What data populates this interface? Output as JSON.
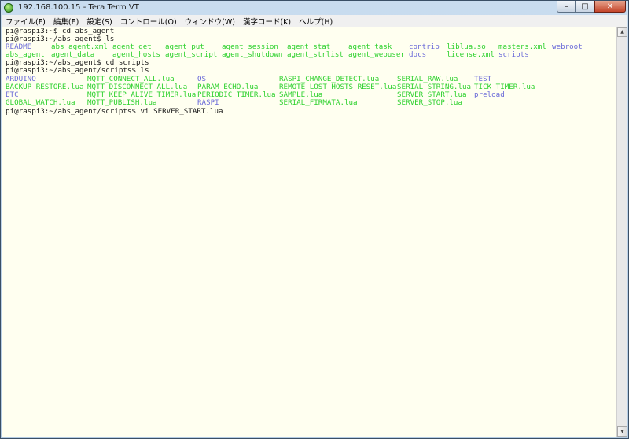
{
  "window": {
    "title": "192.168.100.15 - Tera Term VT",
    "minimize": "–",
    "maximize": "□",
    "close": "✕"
  },
  "menu": [
    "ファイル(F)",
    "編集(E)",
    "設定(S)",
    "コントロール(O)",
    "ウィンドウ(W)",
    "漢字コード(K)",
    "ヘルプ(H)"
  ],
  "colors": {
    "directory": "#6a6ad8",
    "file": "#2ed12e",
    "text": "#1a1a1a",
    "background": "#fffff0"
  },
  "terminal": {
    "prompt1": "pi@raspi3:~$ cd abs_agent",
    "prompt2": "pi@raspi3:~/abs_agent$ ls",
    "ls1_row1": [
      {
        "text": "README",
        "color": "blue"
      },
      {
        "text": "abs_agent.xml",
        "color": "green"
      },
      {
        "text": "agent_get",
        "color": "green"
      },
      {
        "text": "agent_put",
        "color": "green"
      },
      {
        "text": "agent_session",
        "color": "green"
      },
      {
        "text": "agent_stat",
        "color": "green"
      },
      {
        "text": "agent_task",
        "color": "green"
      },
      {
        "text": "contrib",
        "color": "blue"
      },
      {
        "text": "liblua.so",
        "color": "green"
      },
      {
        "text": "masters.xml",
        "color": "green"
      },
      {
        "text": "webroot",
        "color": "blue"
      }
    ],
    "ls1_row2": [
      {
        "text": "abs_agent",
        "color": "green"
      },
      {
        "text": "agent_data",
        "color": "green"
      },
      {
        "text": "agent_hosts",
        "color": "green"
      },
      {
        "text": "agent_script",
        "color": "green"
      },
      {
        "text": "agent_shutdown",
        "color": "green"
      },
      {
        "text": "agent_strlist",
        "color": "green"
      },
      {
        "text": "agent_webuser",
        "color": "green"
      },
      {
        "text": "docs",
        "color": "blue"
      },
      {
        "text": "license.xml",
        "color": "green"
      },
      {
        "text": "scripts",
        "color": "blue"
      }
    ],
    "prompt3": "pi@raspi3:~/abs_agent$ cd scripts",
    "prompt4": "pi@raspi3:~/abs_agent/scripts$ ls",
    "ls2_rows": [
      [
        {
          "text": "ARDUINO",
          "color": "blue"
        },
        {
          "text": "MQTT_CONNECT_ALL.lua",
          "color": "green"
        },
        {
          "text": "OS",
          "color": "blue"
        },
        {
          "text": "RASPI_CHANGE_DETECT.lua",
          "color": "green"
        },
        {
          "text": "SERIAL_RAW.lua",
          "color": "green"
        },
        {
          "text": "TEST",
          "color": "blue"
        }
      ],
      [
        {
          "text": "BACKUP_RESTORE.lua",
          "color": "green"
        },
        {
          "text": "MQTT_DISCONNECT_ALL.lua",
          "color": "green"
        },
        {
          "text": "PARAM_ECHO.lua",
          "color": "green"
        },
        {
          "text": "REMOTE_LOST_HOSTS_RESET.lua",
          "color": "green"
        },
        {
          "text": "SERIAL_STRING.lua",
          "color": "green"
        },
        {
          "text": "TICK_TIMER.lua",
          "color": "green"
        }
      ],
      [
        {
          "text": "ETC",
          "color": "blue"
        },
        {
          "text": "MQTT_KEEP_ALIVE_TIMER.lua",
          "color": "green"
        },
        {
          "text": "PERIODIC_TIMER.lua",
          "color": "green"
        },
        {
          "text": "SAMPLE.lua",
          "color": "green"
        },
        {
          "text": "SERVER_START.lua",
          "color": "green"
        },
        {
          "text": "preload",
          "color": "blue"
        }
      ],
      [
        {
          "text": "GLOBAL_WATCH.lua",
          "color": "green"
        },
        {
          "text": "MQTT_PUBLISH.lua",
          "color": "green"
        },
        {
          "text": "RASPI",
          "color": "blue"
        },
        {
          "text": "SERIAL_FIRMATA.lua",
          "color": "green"
        },
        {
          "text": "SERVER_STOP.lua",
          "color": "green"
        }
      ]
    ],
    "prompt5": "pi@raspi3:~/abs_agent/scripts$ vi SERVER_START.lua"
  },
  "scrollbar": {
    "up_icon": "▲",
    "down_icon": "▼"
  }
}
